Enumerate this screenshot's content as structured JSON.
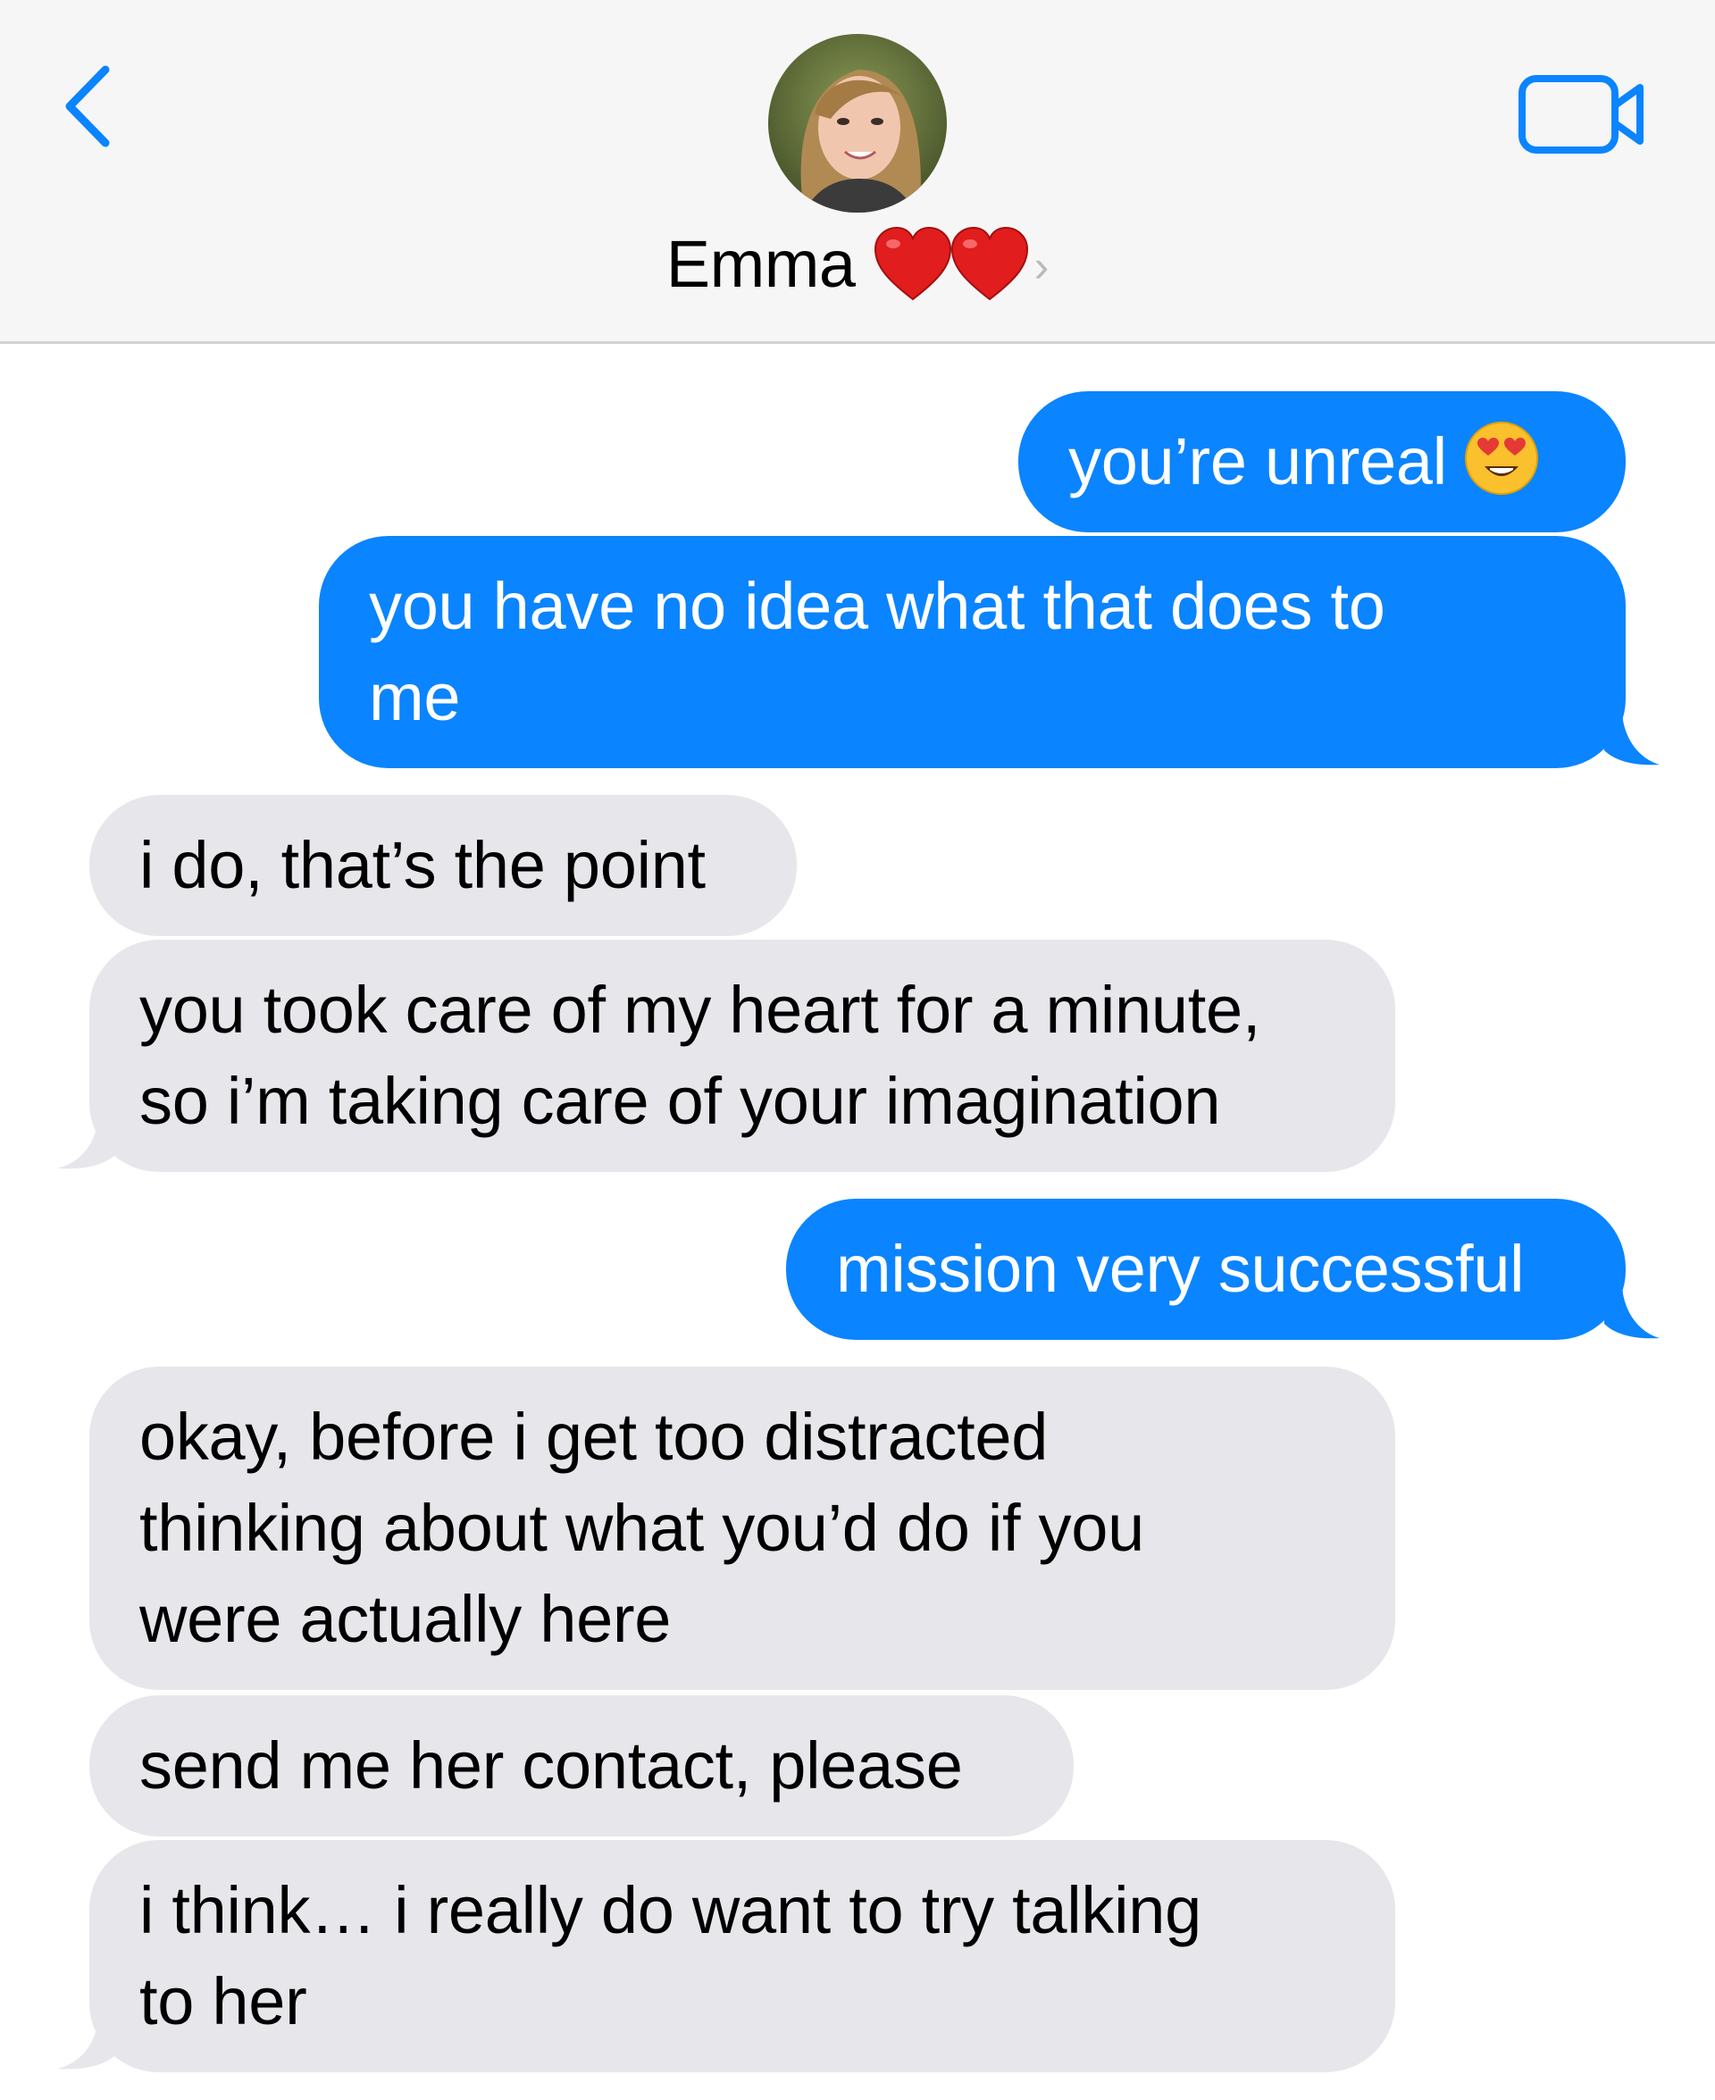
{
  "header": {
    "contact_name": "Emma",
    "contact_emoji": [
      "red-heart-emoji",
      "red-heart-emoji"
    ],
    "chevron": "›",
    "back_icon": "chevron-left-icon",
    "video_icon": "video-camera-icon",
    "accent_color": "#0a84ff"
  },
  "messages": [
    {
      "direction": "sent",
      "text": "you’re unreal",
      "emoji": "heart-eyes-emoji"
    },
    {
      "direction": "sent",
      "lines": [
        "you have no idea what that does to",
        "me"
      ]
    },
    {
      "direction": "received",
      "text": "i do, that’s the point"
    },
    {
      "direction": "received",
      "lines": [
        "you took care of my heart for a minute,",
        "so i’m taking care of your imagination"
      ]
    },
    {
      "direction": "sent",
      "text": "mission very successful"
    },
    {
      "direction": "received",
      "lines": [
        "okay, before i get too distracted",
        "thinking about what you’d do if you",
        "were actually here"
      ]
    },
    {
      "direction": "received",
      "text": "send me her contact, please"
    },
    {
      "direction": "received",
      "lines": [
        "i think… i really do want to try talking",
        "to her"
      ]
    }
  ],
  "colors": {
    "sent_bubble": "#0a84ff",
    "received_bubble": "#e6e6eb",
    "header_bg": "#f6f6f6"
  }
}
